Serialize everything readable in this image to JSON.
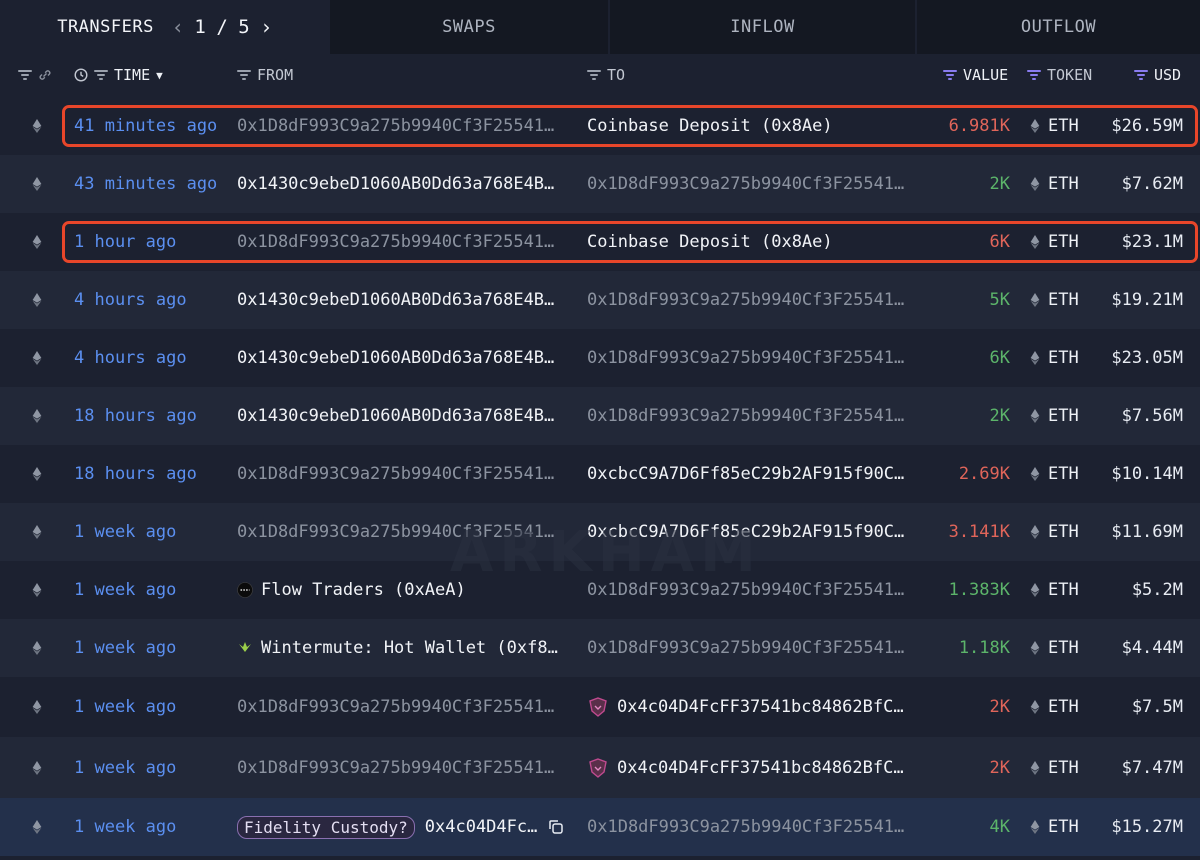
{
  "tabs": {
    "transfers": "TRANSFERS",
    "page_current": "1",
    "page_sep": "/",
    "page_total": "5",
    "swaps": "SWAPS",
    "inflow": "INFLOW",
    "outflow": "OUTFLOW"
  },
  "columns": {
    "time": "TIME",
    "from": "FROM",
    "to": "TO",
    "value": "VALUE",
    "token": "TOKEN",
    "usd": "USD"
  },
  "watermark": "ARKHAM",
  "rows": [
    {
      "time": "41 minutes ago",
      "from": "0x1D8dF993C9a275b9940Cf3F25541…",
      "to": "Coinbase Deposit (0x8Ae)",
      "value": "6.981K",
      "token": "ETH",
      "usd": "$26.59M"
    },
    {
      "time": "43 minutes ago",
      "from": "0x1430c9ebeD1060AB0Dd63a768E4B…",
      "to": "0x1D8dF993C9a275b9940Cf3F25541…",
      "value": "2K",
      "token": "ETH",
      "usd": "$7.62M"
    },
    {
      "time": "1 hour ago",
      "from": "0x1D8dF993C9a275b9940Cf3F25541…",
      "to": "Coinbase Deposit (0x8Ae)",
      "value": "6K",
      "token": "ETH",
      "usd": "$23.1M"
    },
    {
      "time": "4 hours ago",
      "from": "0x1430c9ebeD1060AB0Dd63a768E4B…",
      "to": "0x1D8dF993C9a275b9940Cf3F25541…",
      "value": "5K",
      "token": "ETH",
      "usd": "$19.21M"
    },
    {
      "time": "4 hours ago",
      "from": "0x1430c9ebeD1060AB0Dd63a768E4B…",
      "to": "0x1D8dF993C9a275b9940Cf3F25541…",
      "value": "6K",
      "token": "ETH",
      "usd": "$23.05M"
    },
    {
      "time": "18 hours ago",
      "from": "0x1430c9ebeD1060AB0Dd63a768E4B…",
      "to": "0x1D8dF993C9a275b9940Cf3F25541…",
      "value": "2K",
      "token": "ETH",
      "usd": "$7.56M"
    },
    {
      "time": "18 hours ago",
      "from": "0x1D8dF993C9a275b9940Cf3F25541…",
      "to": "0xcbcC9A7D6Ff85eC29b2AF915f90C…",
      "value": "2.69K",
      "token": "ETH",
      "usd": "$10.14M"
    },
    {
      "time": "1 week ago",
      "from": "0x1D8dF993C9a275b9940Cf3F25541…",
      "to": "0xcbcC9A7D6Ff85eC29b2AF915f90C…",
      "value": "3.141K",
      "token": "ETH",
      "usd": "$11.69M"
    },
    {
      "time": "1 week ago",
      "from": "Flow Traders (0xAeA)",
      "to": "0x1D8dF993C9a275b9940Cf3F25541…",
      "value": "1.383K",
      "token": "ETH",
      "usd": "$5.2M"
    },
    {
      "time": "1 week ago",
      "from": "Wintermute: Hot Wallet (0xf8…",
      "to": "0x1D8dF993C9a275b9940Cf3F25541…",
      "value": "1.18K",
      "token": "ETH",
      "usd": "$4.44M"
    },
    {
      "time": "1 week ago",
      "from": "0x1D8dF993C9a275b9940Cf3F25541…",
      "to": "0x4c04D4FcFF37541bc84862BfC…",
      "value": "2K",
      "token": "ETH",
      "usd": "$7.5M"
    },
    {
      "time": "1 week ago",
      "from": "0x1D8dF993C9a275b9940Cf3F25541…",
      "to": "0x4c04D4FcFF37541bc84862BfC…",
      "value": "2K",
      "token": "ETH",
      "usd": "$7.47M"
    },
    {
      "time": "1 week ago",
      "from_tag": "Fidelity Custody?",
      "from": "0x4c04D4Fc…",
      "to": "0x1D8dF993C9a275b9940Cf3F25541…",
      "value": "4K",
      "token": "ETH",
      "usd": "$15.27M"
    }
  ],
  "colors": {
    "time_link": "#5b8ff0",
    "value_out": "#e0655a",
    "value_in": "#5cb46a",
    "highlight": "#e8462a"
  }
}
